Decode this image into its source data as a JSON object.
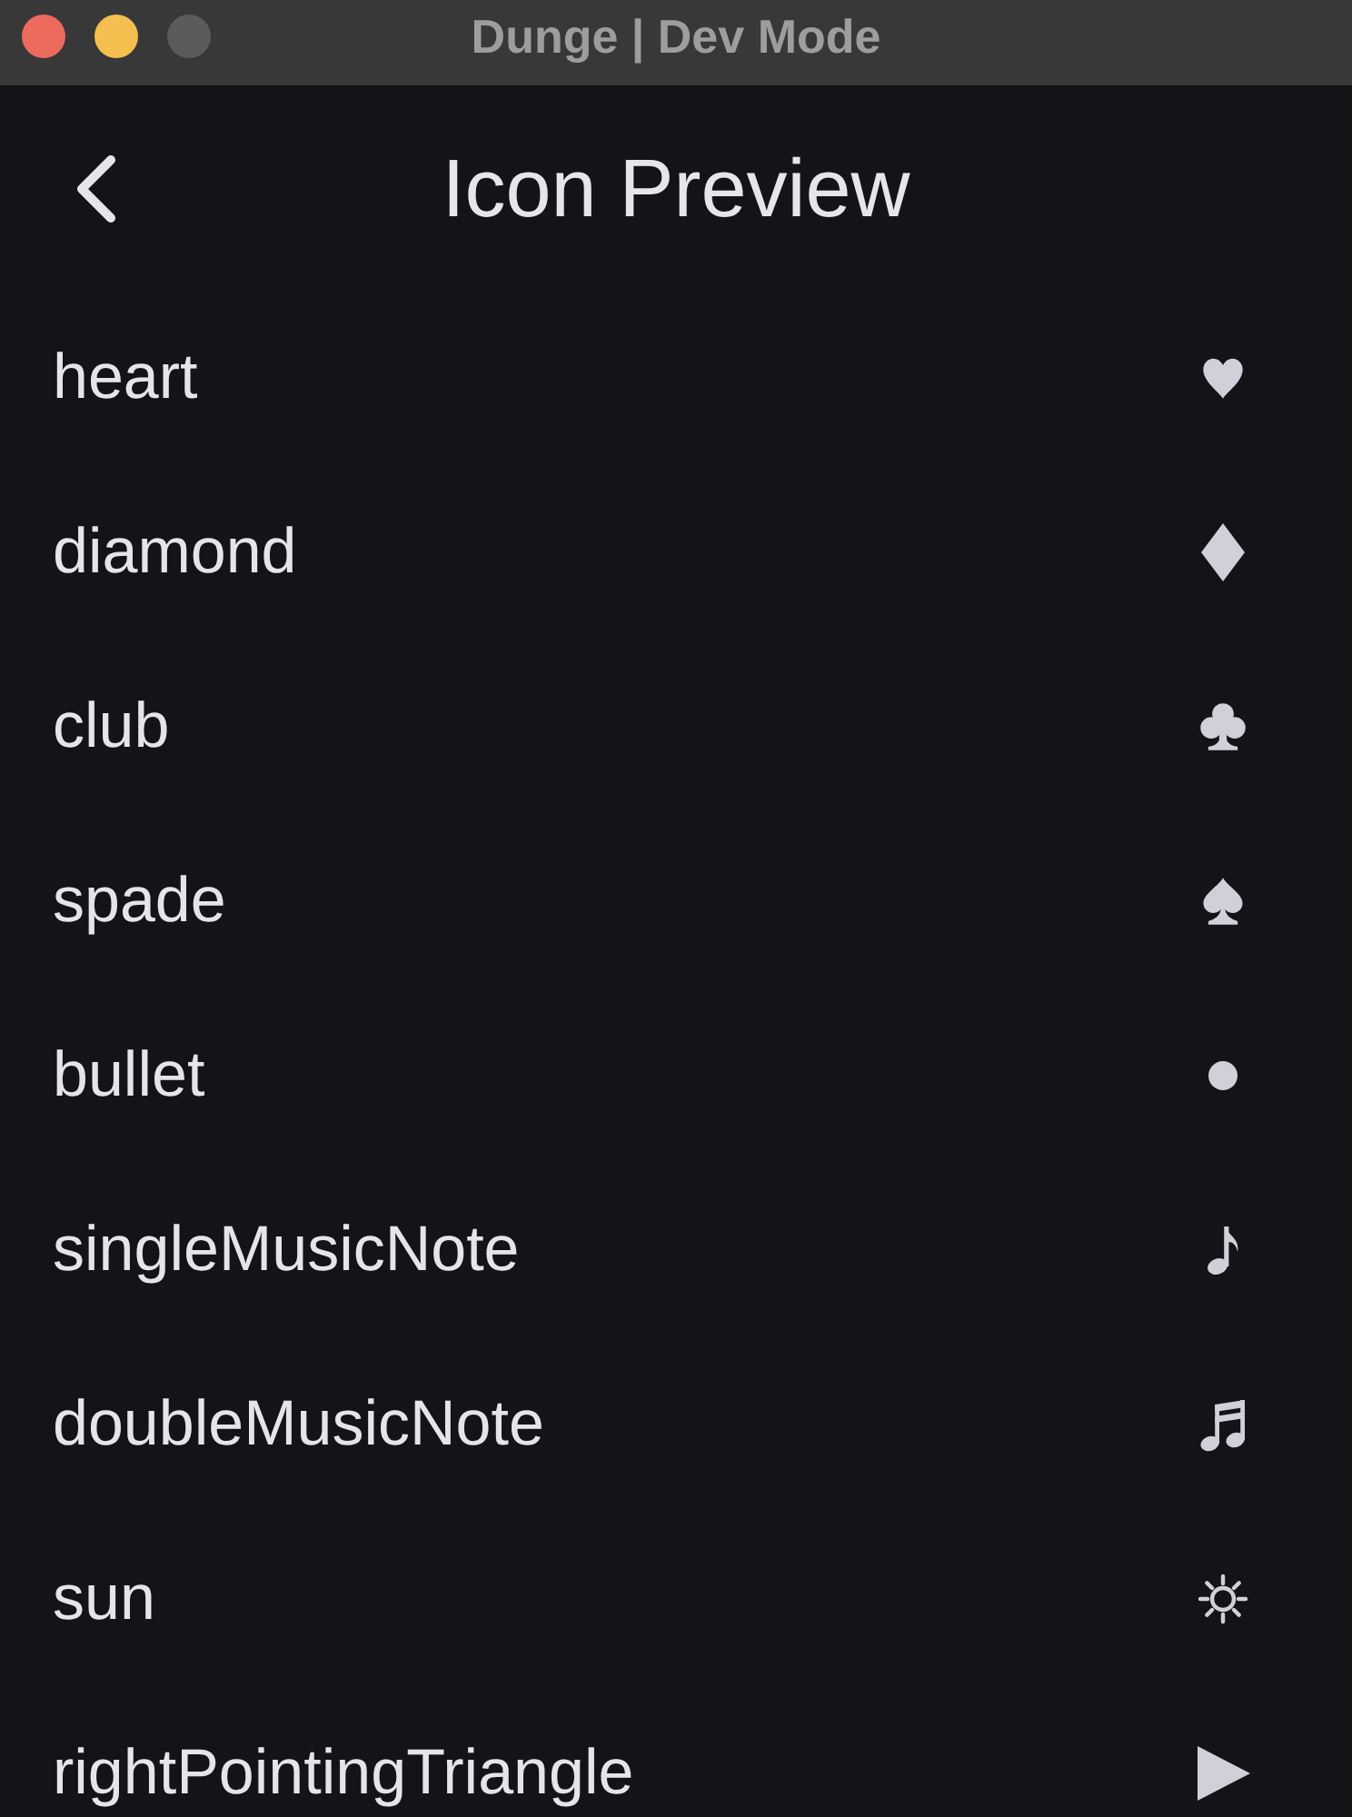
{
  "window": {
    "title": "Dunge | Dev Mode",
    "controls": [
      {
        "kind": "close",
        "disabled": false
      },
      {
        "kind": "minimize",
        "disabled": false
      },
      {
        "kind": "zoom",
        "disabled": true
      }
    ]
  },
  "app_bar": {
    "title": "Icon Preview"
  },
  "items": [
    {
      "label": "heart",
      "kind": "heart"
    },
    {
      "label": "diamond",
      "kind": "diamond"
    },
    {
      "label": "club",
      "kind": "club"
    },
    {
      "label": "spade",
      "kind": "spade"
    },
    {
      "label": "bullet",
      "kind": "bullet"
    },
    {
      "label": "singleMusicNote",
      "kind": "single_note"
    },
    {
      "label": "doubleMusicNote",
      "kind": "double_note"
    },
    {
      "label": "sun",
      "kind": "sun"
    },
    {
      "label": "rightPointingTriangle",
      "kind": "triangle"
    }
  ]
}
